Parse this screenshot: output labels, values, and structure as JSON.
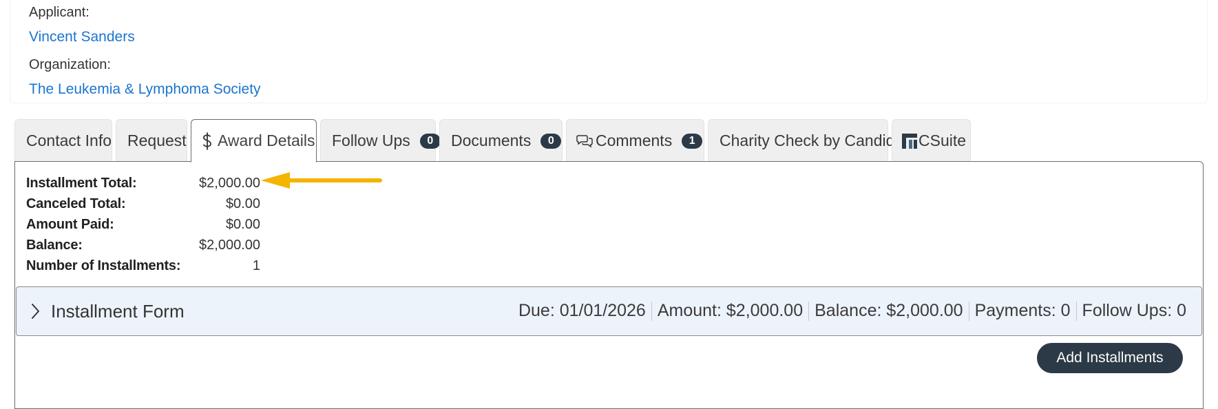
{
  "applicant": {
    "label": "Applicant:",
    "name": "Vincent Sanders"
  },
  "organization": {
    "label": "Organization:",
    "name": "The Leukemia & Lymphoma Society"
  },
  "tabs": [
    {
      "label": "Contact Info"
    },
    {
      "label": "Request"
    },
    {
      "label": "Award Details",
      "icon": "dollar-icon",
      "active": true
    },
    {
      "label": "Follow Ups",
      "badge": "0"
    },
    {
      "label": "Documents",
      "badge": "0"
    },
    {
      "label": "Comments",
      "badge": "1",
      "icon": "comments-icon"
    },
    {
      "label": "Charity Check by Candid"
    },
    {
      "label": "CSuite",
      "icon": "csuite-logo-icon"
    }
  ],
  "summary": [
    {
      "label": "Installment Total:",
      "value": "$2,000.00"
    },
    {
      "label": "Canceled Total:",
      "value": "$0.00"
    },
    {
      "label": "Amount Paid:",
      "value": "$0.00"
    },
    {
      "label": "Balance:",
      "value": "$2,000.00"
    },
    {
      "label": "Number of Installments:",
      "value": "1"
    }
  ],
  "annotation": {
    "icon": "arrow-left-icon",
    "color": "#f5b400"
  },
  "installment": {
    "title": "Installment Form",
    "due": "Due: 01/01/2026",
    "amount": "Amount: $2,000.00",
    "balance": "Balance: $2,000.00",
    "payments": "Payments: 0",
    "follow_ups": "Follow Ups: 0"
  },
  "actions": {
    "add_installments": "Add Installments"
  },
  "colors": {
    "link": "#1b75d0",
    "badge": "#2c3a47",
    "button": "#2c3a47",
    "bar_bg": "#edf3fb"
  }
}
